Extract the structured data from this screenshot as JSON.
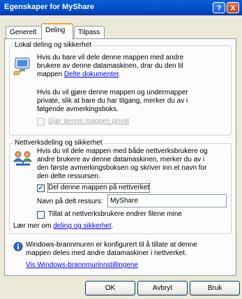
{
  "window": {
    "title": "Egenskaper for MyShare",
    "help_glyph": "?",
    "close_glyph": "X"
  },
  "tabs": [
    {
      "label": "Generelt"
    },
    {
      "label": "Deling"
    },
    {
      "label": "Tilpass"
    }
  ],
  "local_sharing": {
    "legend": "Lokal deling og sikkerhet",
    "text_lines": [
      "Hvis du bare vil dele denne mappen med andre",
      "brukere av denne datamaskinen, drar du den til",
      "mappen "
    ],
    "link_label": "Delte dokumenter",
    "link_suffix": ".",
    "private_lines": [
      "Hvis du vil gjøre denne mappen og undermapper",
      "private, slik at bare du har tilgang, merker du av i",
      "følgende avmerkingsboks."
    ],
    "private_checkbox_label": "Gjør denne mappen privat",
    "icon": "shared-computer-icon"
  },
  "network_sharing": {
    "legend": "Nettverksdeling og sikkerhet",
    "text_lines": [
      "Hvis du vil dele mappen med både nettverksbrukere og",
      "andre brukere av denne datamaskinen, merker du av i",
      "den første avmerkingsboksen og skriver inn et navn for",
      "den delte ressursen."
    ],
    "share_checkbox_label": "Del denne mappen på nettverket",
    "share_checked": true,
    "share_name_label": "Navn på delt ressurs:",
    "share_name_value": "MyShare",
    "allow_change_label": "Tillat at nettverksbrukere endrer filene mine",
    "allow_change_checked": false,
    "learn_prefix": "Lær mer om ",
    "learn_link": "deling og sikkerhet",
    "learn_suffix": ".",
    "icon": "network-users-icon"
  },
  "firewall": {
    "lines": [
      "Windows-brannmuren er konfigurert til å tillate at denne",
      "mappen deles med andre datamaskiner i nettverket."
    ],
    "link": "Vis Windows-brannmurinnstillingene",
    "icon": "info-icon"
  },
  "buttons": {
    "ok": "OK",
    "cancel": "Avbryt",
    "apply": "Bruk"
  }
}
